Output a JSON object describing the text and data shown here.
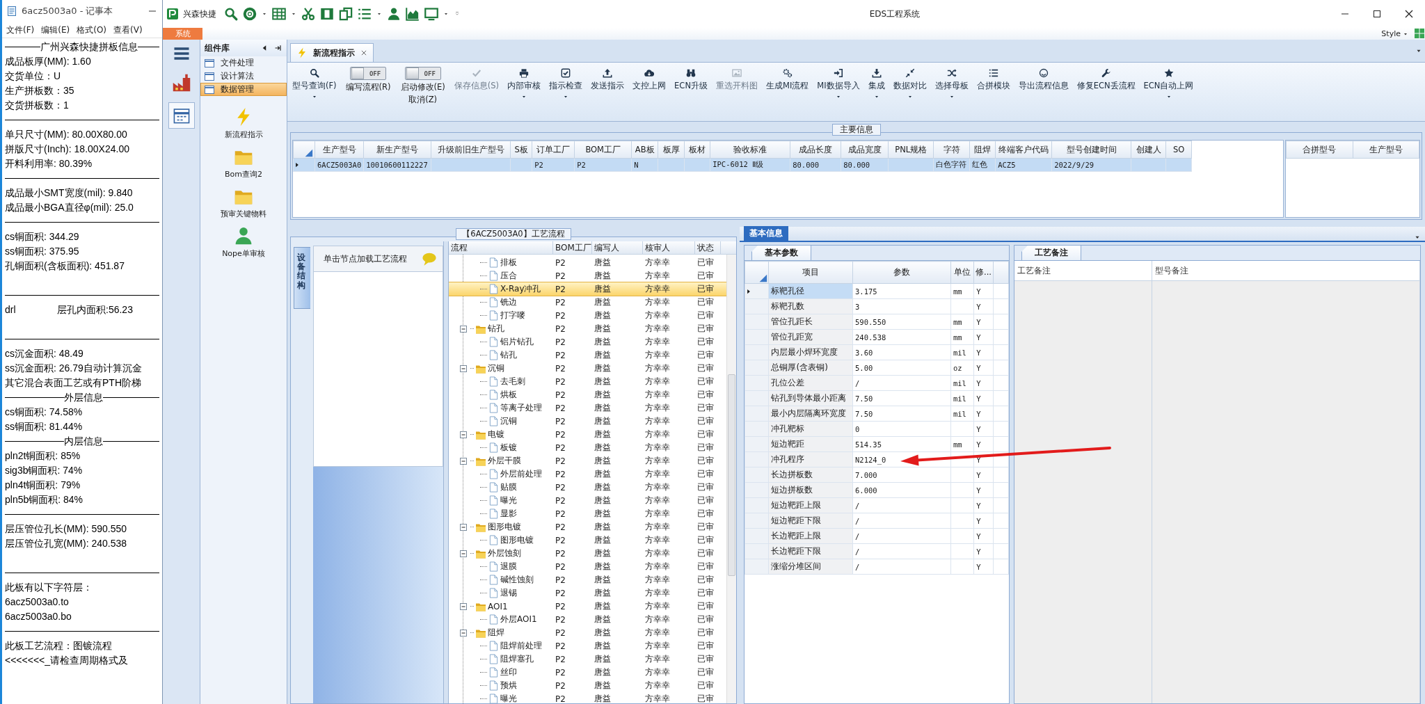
{
  "notepad": {
    "title": "6acz5003a0 - 记事本",
    "menu": [
      "文件(F)",
      "编辑(E)",
      "格式(O)",
      "查看(V)"
    ],
    "lines": [
      {
        "kind": "heading",
        "text": "广州兴森快捷拼板信息"
      },
      {
        "kind": "text",
        "text": "成品板厚(MM): 1.60"
      },
      {
        "kind": "text",
        "text": "交货单位：U"
      },
      {
        "kind": "text",
        "text": "生产拼板数：35"
      },
      {
        "kind": "text",
        "text": "交货拼板数：1"
      },
      {
        "kind": "rule"
      },
      {
        "kind": "text",
        "text": "单只尺寸(MM): 80.00X80.00"
      },
      {
        "kind": "text",
        "text": "拼版尺寸(Inch): 18.00X24.00"
      },
      {
        "kind": "text",
        "text": "开料利用率: 80.39%"
      },
      {
        "kind": "rule"
      },
      {
        "kind": "text",
        "text": "成品最小SMT宽度(mil): 9.840"
      },
      {
        "kind": "text",
        "text": "成品最小BGA直径φ(mil):  25.0"
      },
      {
        "kind": "rule"
      },
      {
        "kind": "text",
        "text": "cs铜面积: 344.29"
      },
      {
        "kind": "text",
        "text": "ss铜面积: 375.95"
      },
      {
        "kind": "text",
        "text": "孔铜面积(含板面积): 451.87"
      },
      {
        "kind": "blank"
      },
      {
        "kind": "rule"
      },
      {
        "kind": "split",
        "parts": [
          "drl",
          "层孔内面积:56.23"
        ]
      },
      {
        "kind": "blank"
      },
      {
        "kind": "rule"
      },
      {
        "kind": "text",
        "text": "cs沉金面积: 48.49"
      },
      {
        "kind": "text",
        "text": "ss沉金面积: 26.79自动计算沉金"
      },
      {
        "kind": "text",
        "text": "其它混合表面工艺或有PTH阶梯"
      },
      {
        "kind": "heading",
        "text": "外层信息"
      },
      {
        "kind": "text",
        "text": "cs铜面积: 74.58%"
      },
      {
        "kind": "text",
        "text": "ss铜面积: 81.44%"
      },
      {
        "kind": "heading",
        "text": "内层信息"
      },
      {
        "kind": "text",
        "text": "pln2t铜面积: 85%"
      },
      {
        "kind": "text",
        "text": "sig3b铜面积: 74%"
      },
      {
        "kind": "text",
        "text": "pln4t铜面积: 79%"
      },
      {
        "kind": "text",
        "text": "pln5b铜面积: 84%"
      },
      {
        "kind": "rule"
      },
      {
        "kind": "text",
        "text": "层压管位孔长(MM): 590.550"
      },
      {
        "kind": "text",
        "text": "层压管位孔宽(MM): 240.538"
      },
      {
        "kind": "blank"
      },
      {
        "kind": "rule"
      },
      {
        "kind": "text",
        "text": "此板有以下字符层："
      },
      {
        "kind": "text",
        "text": "6acz5003a0.to"
      },
      {
        "kind": "text",
        "text": "6acz5003a0.bo"
      },
      {
        "kind": "rule"
      },
      {
        "kind": "text",
        "text": "此板工艺流程：图镀流程"
      },
      {
        "kind": "text",
        "text": "<<<<<<<_请检查周期格式及"
      }
    ]
  },
  "app": {
    "brand": "兴森快捷",
    "title": "EDS工程系统",
    "system_tab": "系统",
    "style_menu": "Style"
  },
  "nav": {
    "title": "组件库",
    "categories": [
      {
        "label": "文件处理",
        "selected": false
      },
      {
        "label": "设计算法",
        "selected": false
      },
      {
        "label": "数据管理",
        "selected": true
      }
    ],
    "tools": [
      "新流程指示",
      "Bom查询2",
      "预审关键物料",
      "Nope单审核"
    ]
  },
  "tabs": [
    {
      "label": "新流程指示",
      "selected": true
    }
  ],
  "ribbon": [
    {
      "kind": "button",
      "label": "型号查询(F)",
      "disabled": false,
      "dropdown": true
    },
    {
      "kind": "toggle",
      "label": "编写流程(R)",
      "switch_text": "OFF",
      "on": false,
      "disabled": false,
      "dropdown": false
    },
    {
      "kind": "toggle",
      "label": "启动修改(E)",
      "second_label": "取消(Z)",
      "switch_text": "OFF",
      "on": false,
      "disabled": false,
      "dropdown": false
    },
    {
      "kind": "button",
      "label": "保存信息(S)",
      "disabled": true,
      "dropdown": false
    },
    {
      "kind": "button",
      "label": "内部审核",
      "disabled": false,
      "dropdown": true
    },
    {
      "kind": "button",
      "label": "指示检查",
      "disabled": false,
      "dropdown": true
    },
    {
      "kind": "button",
      "label": "发送指示",
      "disabled": false,
      "dropdown": false
    },
    {
      "kind": "button",
      "label": "文控上网",
      "disabled": false,
      "dropdown": false
    },
    {
      "kind": "button",
      "label": "ECN升级",
      "disabled": false,
      "dropdown": false
    },
    {
      "kind": "button",
      "label": "重选开料图",
      "disabled": true,
      "dropdown": false
    },
    {
      "kind": "button",
      "label": "生成MI流程",
      "disabled": false,
      "dropdown": false
    },
    {
      "kind": "button",
      "label": "MI数据导入",
      "disabled": false,
      "dropdown": true
    },
    {
      "kind": "button",
      "label": "集成",
      "disabled": false,
      "dropdown": true
    },
    {
      "kind": "button",
      "label": "数据对比",
      "disabled": false,
      "dropdown": true
    },
    {
      "kind": "button",
      "label": "选择母板",
      "disabled": false,
      "dropdown": true
    },
    {
      "kind": "button",
      "label": "合拼模块",
      "disabled": false,
      "dropdown": false
    },
    {
      "kind": "button",
      "label": "导出流程信息",
      "disabled": false,
      "dropdown": false
    },
    {
      "kind": "button",
      "label": "修复ECN丢流程",
      "disabled": false,
      "dropdown": false
    },
    {
      "kind": "button",
      "label": "ECN自动上网",
      "disabled": false,
      "dropdown": true
    }
  ],
  "main_info": {
    "title": "主要信息",
    "columns": [
      "生产型号",
      "新生产型号",
      "升级前旧生产型号",
      "S板",
      "订单工厂",
      "BOM工厂",
      "AB板",
      "板厚",
      "板材",
      "验收标准",
      "成品长度",
      "成品宽度",
      "PNL规格",
      "字符",
      "阻焊",
      "终端客户代码",
      "型号创建时间",
      "创建人",
      "SO"
    ],
    "rows": [
      {
        "selected": true,
        "cells": [
          "6ACZ5003A0",
          "10010600112227",
          null,
          null,
          "P2",
          "P2",
          "N",
          null,
          null,
          "IPC-6012 Ⅱ级",
          "80.000",
          "80.000",
          null,
          "白色字符",
          "红色",
          "ACZ5",
          "2022/9/29",
          null,
          null
        ]
      }
    ],
    "side_columns": [
      "合拼型号",
      "生产型号"
    ]
  },
  "flow": {
    "title": "【6ACZ5003A0】工艺流程",
    "side_tab": "设备结构",
    "hint": "单击节点加载工艺流程",
    "columns": [
      "流程",
      "BOM工厂",
      "编写人",
      "核审人",
      "状态"
    ],
    "tree": [
      {
        "children": [
          {
            "label": "排板",
            "bom": "P2",
            "writer": "唐益",
            "reviewer": "方幸幸",
            "status": "已审",
            "selected": false
          },
          {
            "label": "压合",
            "bom": "P2",
            "writer": "唐益",
            "reviewer": "方幸幸",
            "status": "已审",
            "selected": false
          },
          {
            "label": "X-Ray冲孔",
            "bom": "P2",
            "writer": "唐益",
            "reviewer": "方幸幸",
            "status": "已审",
            "selected": true
          },
          {
            "label": "铣边",
            "bom": "P2",
            "writer": "唐益",
            "reviewer": "方幸幸",
            "status": "已审",
            "selected": false
          },
          {
            "label": "打字嘜",
            "bom": "P2",
            "writer": "唐益",
            "reviewer": "方幸幸",
            "status": "已审",
            "selected": false
          }
        ]
      },
      {
        "label": "钻孔",
        "bom": "P2",
        "writer": "唐益",
        "reviewer": "方幸幸",
        "status": "已审",
        "selected": false,
        "expanded": true,
        "children": [
          {
            "label": "铝片钻孔",
            "bom": "P2",
            "writer": "唐益",
            "reviewer": "方幸幸",
            "status": "已审",
            "selected": false
          },
          {
            "label": "钻孔",
            "bom": "P2",
            "writer": "唐益",
            "reviewer": "方幸幸",
            "status": "已审",
            "selected": false
          }
        ]
      },
      {
        "label": "沉铜",
        "bom": "P2",
        "writer": "唐益",
        "reviewer": "方幸幸",
        "status": "已审",
        "selected": false,
        "expanded": true,
        "children": [
          {
            "label": "去毛刺",
            "bom": "P2",
            "writer": "唐益",
            "reviewer": "方幸幸",
            "status": "已审",
            "selected": false
          },
          {
            "label": "烘板",
            "bom": "P2",
            "writer": "唐益",
            "reviewer": "方幸幸",
            "status": "已审",
            "selected": false
          },
          {
            "label": "等离子处理",
            "bom": "P2",
            "writer": "唐益",
            "reviewer": "方幸幸",
            "status": "已审",
            "selected": false
          },
          {
            "label": "沉铜",
            "bom": "P2",
            "writer": "唐益",
            "reviewer": "方幸幸",
            "status": "已审",
            "selected": false
          }
        ]
      },
      {
        "label": "电镀",
        "bom": "P2",
        "writer": "唐益",
        "reviewer": "方幸幸",
        "status": "已审",
        "selected": false,
        "expanded": true,
        "children": [
          {
            "label": "板镀",
            "bom": "P2",
            "writer": "唐益",
            "reviewer": "方幸幸",
            "status": "已审",
            "selected": false
          }
        ]
      },
      {
        "label": "外层干膜",
        "bom": "P2",
        "writer": "唐益",
        "reviewer": "方幸幸",
        "status": "已审",
        "selected": false,
        "expanded": true,
        "children": [
          {
            "label": "外层前处理",
            "bom": "P2",
            "writer": "唐益",
            "reviewer": "方幸幸",
            "status": "已审",
            "selected": false
          },
          {
            "label": "贴膜",
            "bom": "P2",
            "writer": "唐益",
            "reviewer": "方幸幸",
            "status": "已审",
            "selected": false
          },
          {
            "label": "曝光",
            "bom": "P2",
            "writer": "唐益",
            "reviewer": "方幸幸",
            "status": "已审",
            "selected": false
          },
          {
            "label": "显影",
            "bom": "P2",
            "writer": "唐益",
            "reviewer": "方幸幸",
            "status": "已审",
            "selected": false
          }
        ]
      },
      {
        "label": "图形电镀",
        "bom": "P2",
        "writer": "唐益",
        "reviewer": "方幸幸",
        "status": "已审",
        "selected": false,
        "expanded": true,
        "children": [
          {
            "label": "图形电镀",
            "bom": "P2",
            "writer": "唐益",
            "reviewer": "方幸幸",
            "status": "已审",
            "selected": false
          }
        ]
      },
      {
        "label": "外层蚀刻",
        "bom": "P2",
        "writer": "唐益",
        "reviewer": "方幸幸",
        "status": "已审",
        "selected": false,
        "expanded": true,
        "children": [
          {
            "label": "退膜",
            "bom": "P2",
            "writer": "唐益",
            "reviewer": "方幸幸",
            "status": "已审",
            "selected": false
          },
          {
            "label": "碱性蚀刻",
            "bom": "P2",
            "writer": "唐益",
            "reviewer": "方幸幸",
            "status": "已审",
            "selected": false
          },
          {
            "label": "退锡",
            "bom": "P2",
            "writer": "唐益",
            "reviewer": "方幸幸",
            "status": "已审",
            "selected": false
          }
        ]
      },
      {
        "label": "AOI1",
        "bom": "P2",
        "writer": "唐益",
        "reviewer": "方幸幸",
        "status": "已审",
        "selected": false,
        "expanded": true,
        "children": [
          {
            "label": "外层AOI1",
            "bom": "P2",
            "writer": "唐益",
            "reviewer": "方幸幸",
            "status": "已审",
            "selected": false
          }
        ]
      },
      {
        "label": "阻焊",
        "bom": "P2",
        "writer": "唐益",
        "reviewer": "方幸幸",
        "status": "已审",
        "selected": false,
        "expanded": true,
        "children": [
          {
            "label": "阻焊前处理",
            "bom": "P2",
            "writer": "唐益",
            "reviewer": "方幸幸",
            "status": "已审",
            "selected": false
          },
          {
            "label": "阻焊塞孔",
            "bom": "P2",
            "writer": "唐益",
            "reviewer": "方幸幸",
            "status": "已审",
            "selected": false
          },
          {
            "label": "丝印",
            "bom": "P2",
            "writer": "唐益",
            "reviewer": "方幸幸",
            "status": "已审",
            "selected": false
          },
          {
            "label": "预烘",
            "bom": "P2",
            "writer": "唐益",
            "reviewer": "方幸幸",
            "status": "已审",
            "selected": false
          },
          {
            "label": "曝光",
            "bom": "P2",
            "writer": "唐益",
            "reviewer": "方幸幸",
            "status": "已审",
            "selected": false
          }
        ]
      }
    ]
  },
  "basic_info": {
    "title": "基本信息",
    "params": {
      "tab": "基本参数",
      "columns": [
        "项目",
        "参数",
        "单位",
        "修..."
      ],
      "rows": [
        {
          "item": "标靶孔径",
          "value": "3.175",
          "unit": "mm",
          "mod": "Y",
          "selected": true
        },
        {
          "item": "标靶孔数",
          "value": "3",
          "mod": "Y",
          "selected": false
        },
        {
          "item": "管位孔距长",
          "value": "590.550",
          "unit": "mm",
          "mod": "Y",
          "selected": false
        },
        {
          "item": "管位孔距宽",
          "value": "240.538",
          "unit": "mm",
          "mod": "Y",
          "selected": false
        },
        {
          "item": "内层最小焊环宽度",
          "value": "3.60",
          "unit": "mil",
          "mod": "Y",
          "selected": false
        },
        {
          "item": "总铜厚(含表铜)",
          "value": "5.00",
          "unit": "oz",
          "mod": "Y",
          "selected": false
        },
        {
          "item": "孔位公差",
          "value": "/",
          "unit": "mil",
          "mod": "Y",
          "selected": false
        },
        {
          "item": "钻孔到导体最小距离",
          "value": "7.50",
          "unit": "mil",
          "mod": "Y",
          "selected": false
        },
        {
          "item": "最小内层隔离环宽度",
          "value": "7.50",
          "unit": "mil",
          "mod": "Y",
          "selected": false
        },
        {
          "item": "冲孔靶标",
          "value": "0",
          "mod": "Y",
          "selected": false
        },
        {
          "item": "短边靶距",
          "value": "514.35",
          "unit": "mm",
          "mod": "Y",
          "selected": false
        },
        {
          "item": "冲孔程序",
          "value": "N2124_0",
          "mod": "Y",
          "selected": false
        },
        {
          "item": "长边拼板数",
          "value": "7.000",
          "mod": "Y",
          "selected": false
        },
        {
          "item": "短边拼板数",
          "value": "6.000",
          "mod": "Y",
          "selected": false
        },
        {
          "item": "短边靶距上限",
          "value": "/",
          "mod": "Y",
          "selected": false
        },
        {
          "item": "短边靶距下限",
          "value": "/",
          "mod": "Y",
          "selected": false
        },
        {
          "item": "长边靶距上限",
          "value": "/",
          "mod": "Y",
          "selected": false
        },
        {
          "item": "长边靶距下限",
          "value": "/",
          "mod": "Y",
          "selected": false
        },
        {
          "item": "涨缩分堆区间",
          "value": "/",
          "mod": "Y",
          "selected": false
        }
      ]
    },
    "notes": {
      "tab": "工艺备注",
      "columns": [
        "工艺备注",
        "型号备注"
      ]
    }
  }
}
